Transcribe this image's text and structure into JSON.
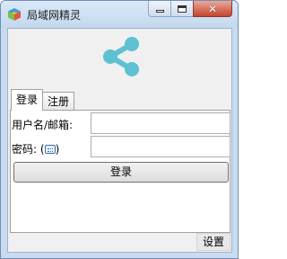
{
  "window": {
    "title": "局域网精灵",
    "minimize_icon": "minimize-icon",
    "maximize_icon": "maximize-icon",
    "close_icon": "close-icon",
    "close_glyph": "✕"
  },
  "header": {
    "icon": "share-icon",
    "accent_color": "#5ec1d1"
  },
  "tabs": [
    {
      "label": "登录",
      "active": true
    },
    {
      "label": "注册",
      "active": false
    }
  ],
  "form": {
    "username_label": "用户名/邮箱:",
    "username_value": "",
    "password_label": "密码:",
    "password_value": "",
    "keyboard_icon": "keyboard-icon",
    "paren_open": "(",
    "paren_close": ")",
    "login_button": "登录"
  },
  "footer": {
    "settings_button": "设置"
  }
}
